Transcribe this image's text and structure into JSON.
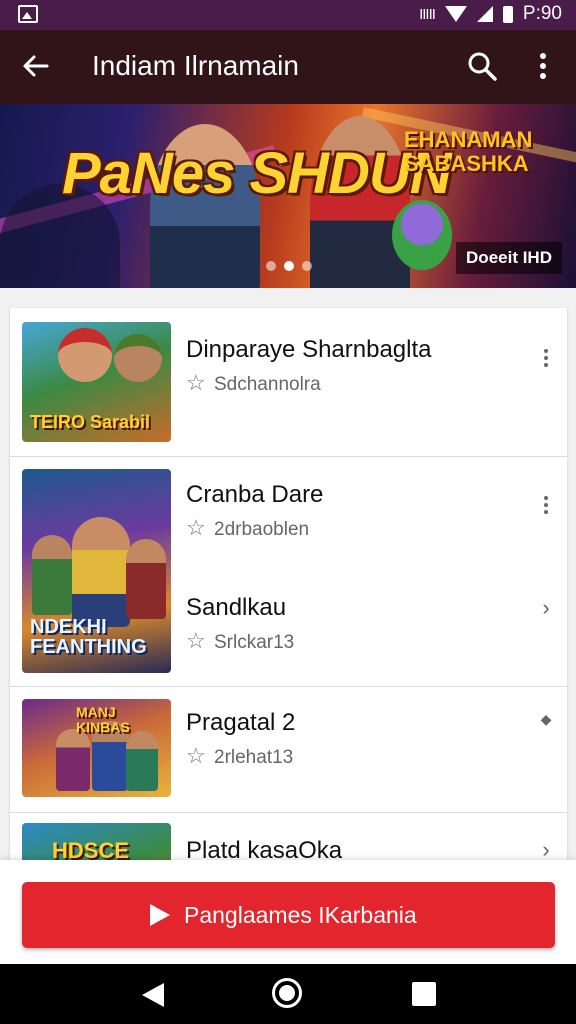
{
  "status_bar": {
    "time": "P:90",
    "signal_text": "ΙΙΙΙΙ"
  },
  "toolbar": {
    "title": "Indiam Ilrnamain"
  },
  "banner": {
    "headline": "PaNes SHDUN",
    "subhead": "EHANAMAN SABASHKA",
    "badge": "Doeeit IHD",
    "slide_count": 3,
    "active_slide": 1
  },
  "list": [
    {
      "title": "Dinparaye Sharnbaglta",
      "subtitle": "Sdchannolra",
      "thumb_label": "TEIRO Sarabil",
      "action": "more-vert-icon"
    },
    {
      "title": "Cranba Dare",
      "subtitle": "2drbaoblen",
      "thumb_label": "NDEKHI FEANTHING",
      "action": "more-vert-icon"
    },
    {
      "title": "Sandlkau",
      "subtitle": "Srlckar13",
      "thumb_label": "",
      "action": "chevron-right-icon"
    },
    {
      "title": "Pragatal 2",
      "subtitle": "2rlehat13",
      "thumb_label": "MANJ KINBAS",
      "action": "small-dot-icon"
    },
    {
      "title": "Platd kasaOka",
      "subtitle": "",
      "thumb_label": "HDSCE",
      "action": "chevron-right-icon"
    }
  ],
  "cta": {
    "label": "Panglaames IKarbania"
  },
  "colors": {
    "accent": "#e3262d",
    "toolbar": "#301418",
    "status_bar": "#4a1c4a"
  }
}
